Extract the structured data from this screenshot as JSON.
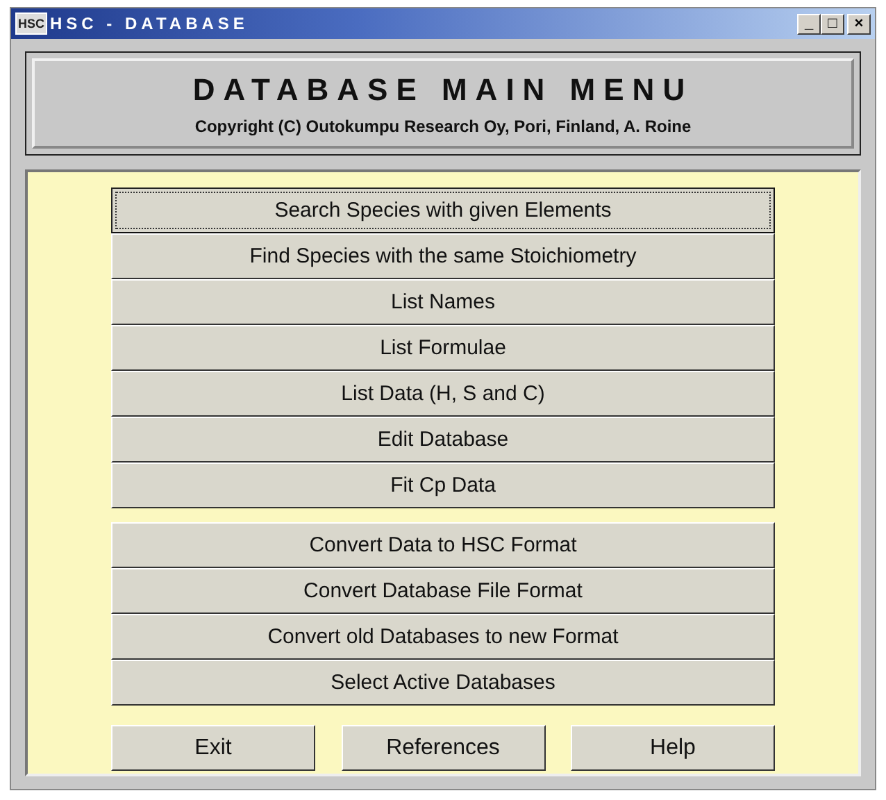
{
  "window": {
    "icon_text": "HSC",
    "title": "HSC - DATABASE",
    "controls": [
      "_",
      "□",
      "×"
    ]
  },
  "header": {
    "title": "DATABASE MAIN MENU",
    "copyright": "Copyright (C) Outokumpu Research Oy, Pori, Finland, A. Roine"
  },
  "menu_groups": [
    {
      "buttons": [
        {
          "label": "Search Species with given Elements",
          "focused": true
        },
        {
          "label": "Find Species with the same Stoichiometry",
          "focused": false
        },
        {
          "label": "List Names",
          "focused": false
        },
        {
          "label": "List Formulae",
          "focused": false
        },
        {
          "label": "List Data (H, S and C)",
          "focused": false
        },
        {
          "label": "Edit Database",
          "focused": false
        },
        {
          "label": "Fit Cp Data",
          "focused": false
        }
      ]
    },
    {
      "buttons": [
        {
          "label": "Convert Data to HSC Format",
          "focused": false
        },
        {
          "label": "Convert Database File Format",
          "focused": false
        },
        {
          "label": "Convert old Databases to new Format",
          "focused": false
        },
        {
          "label": "Select Active Databases",
          "focused": false
        }
      ]
    }
  ],
  "bottom_buttons": [
    "Exit",
    "References",
    "Help"
  ]
}
